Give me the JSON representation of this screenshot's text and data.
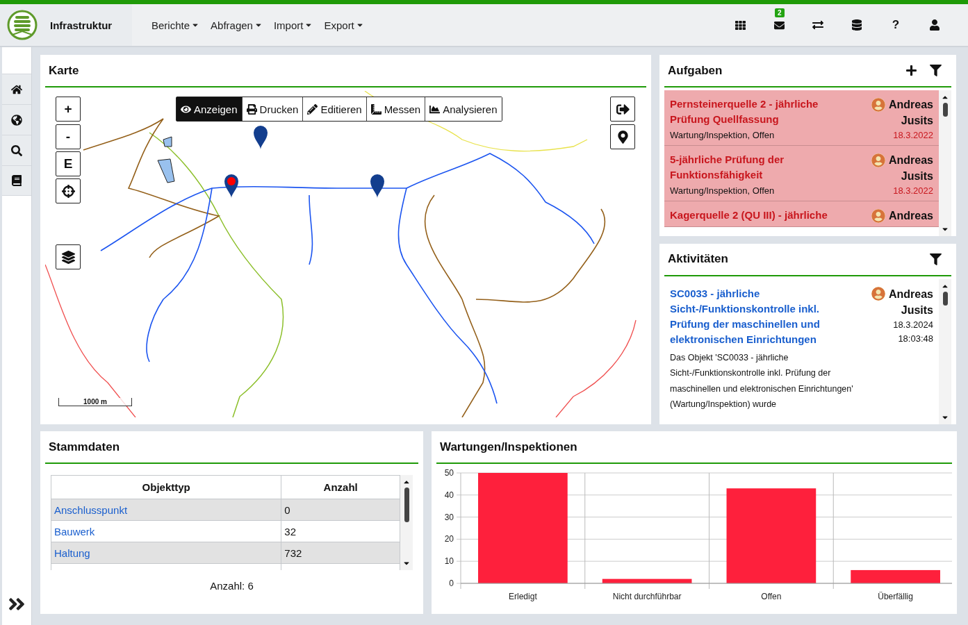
{
  "header": {
    "app_title": "Infrastruktur",
    "menus": [
      {
        "label": "Berichte"
      },
      {
        "label": "Abfragen"
      },
      {
        "label": "Import"
      },
      {
        "label": "Export"
      }
    ],
    "mail_badge": "2",
    "help": "?"
  },
  "map": {
    "title": "Karte",
    "zoom_in": "+",
    "zoom_out": "-",
    "extent": "E",
    "scale": "1000 m",
    "tools": [
      {
        "label": "Anzeigen",
        "selected": true
      },
      {
        "label": "Drucken",
        "selected": false
      },
      {
        "label": "Editieren",
        "selected": false
      },
      {
        "label": "Messen",
        "selected": false
      },
      {
        "label": "Analysieren",
        "selected": false
      }
    ]
  },
  "tasks": {
    "title": "Aufgaben",
    "items": [
      {
        "title": "Pernsteinerquelle 2 - jährliche Prüfung Quellfassung",
        "subtitle": "Wartung/Inspektion, Offen",
        "first_name": "Andreas",
        "last_name": "Jusits",
        "date": "18.3.2022"
      },
      {
        "title": "5-jährliche Prüfung der Funktionsfähigkeit",
        "subtitle": "Wartung/Inspektion, Offen",
        "first_name": "Andreas",
        "last_name": "Jusits",
        "date": "18.3.2022"
      },
      {
        "title": "Kagerquelle 2 (QU III) - jährliche",
        "first_name": "Andreas"
      }
    ]
  },
  "activities": {
    "title": "Aktivitäten",
    "items": [
      {
        "title": "SC0033 - jährliche Sicht-/Funktionskontrolle inkl. Prüfung der maschinellen und elektronischen Einrichtungen",
        "description": "Das Objekt 'SC0033 - jährliche Sicht-/Funktionskontrolle inkl. Prüfung der maschinellen und elektronischen Einrichtungen' (Wartung/Inspektion) wurde",
        "first_name": "Andreas",
        "last_name": "Jusits",
        "date": "18.3.2024",
        "time": "18:03:48"
      }
    ]
  },
  "master_data": {
    "title": "Stammdaten",
    "columns": [
      "Objekttyp",
      "Anzahl"
    ],
    "rows": [
      {
        "type": "Anschlusspunkt",
        "count": "0"
      },
      {
        "type": "Bauwerk",
        "count": "32"
      },
      {
        "type": "Haltung",
        "count": "732"
      }
    ],
    "footer": "Anzahl: 6"
  },
  "maintenance": {
    "title": "Wartungen/Inspektionen",
    "chart_data": {
      "type": "bar",
      "categories": [
        "Erledigt",
        "Nicht durchführbar",
        "Offen",
        "Überfällig"
      ],
      "series": [
        {
          "color": "#fe203c",
          "values": [
            50,
            2,
            43,
            6
          ]
        }
      ],
      "ylim": [
        0,
        50
      ],
      "yticks": [
        0,
        10,
        20,
        30,
        40,
        50
      ],
      "grid": true
    }
  }
}
